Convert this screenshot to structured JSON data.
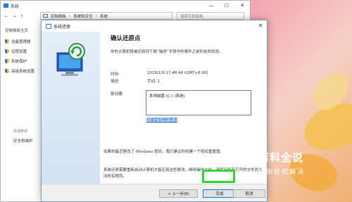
{
  "background_window": {
    "title": "系统",
    "window_controls": [
      "—",
      "☐",
      "✕"
    ],
    "nav_buttons": [
      "←",
      "→",
      "↑"
    ],
    "breadcrumb": [
      "控制面板",
      "系统和安全",
      "系统"
    ],
    "search_placeholder": "搜索控制面板",
    "left_nav": {
      "home": "控制面板主页",
      "items": [
        "设备管理器",
        "远程设置",
        "系统保护",
        "高级系统设置"
      ]
    },
    "see_also_header": "另请参阅",
    "see_also_item": "安全和维护"
  },
  "dialog": {
    "title": "系统还原",
    "close": "✕",
    "heading": "确认还原点",
    "subtitle": "你的计算机将被还原到下面“描述”字段中的事件之前所处的状态。",
    "time_label": "时间:",
    "time_value": "2018/1/9 17:48:48 (GMT+8:00)",
    "desc_label": "描述:",
    "desc_value": "手动: 1",
    "drives_label": "驱动器:",
    "drives_value": "本地磁盘 (C:) (系统)",
    "scan_link": "扫描受影响的程序",
    "note1": "如果你最近更改了 Windows 密码，我们建议你创建一个密码重置盘。",
    "note2": "系统还原需要重新启动计算机才能应用这些更改。继续操作之前，请保存所有打开的文件并关闭所有程序。",
    "back_button": "< 上一步(B)",
    "finish_button": "完成",
    "cancel_button": "取消"
  },
  "watermark": {
    "top": "百科全说",
    "bottom": "助你轻松解决"
  },
  "colors": {
    "highlight": "#2cd92c",
    "link": "#0055cc",
    "sidebar": "#d2e2f2"
  }
}
